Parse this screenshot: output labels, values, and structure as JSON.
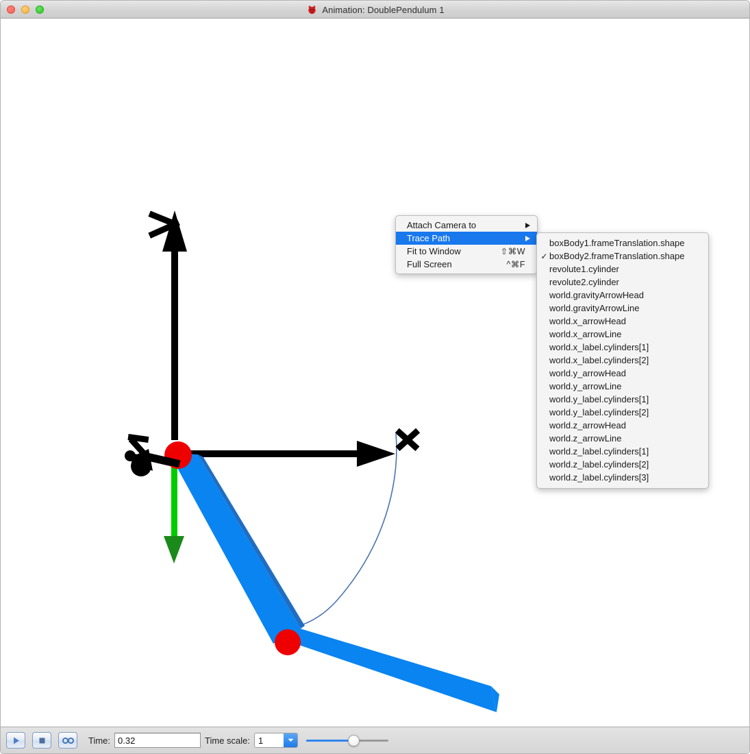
{
  "window": {
    "title": "Animation: DoublePendulum 1",
    "app_icon": "modelica-red-icon",
    "traffic_lights": [
      "close",
      "minimize",
      "maximize"
    ]
  },
  "context_menu": {
    "items": [
      {
        "label": "Attach Camera to",
        "shortcut": "",
        "submenu": true,
        "selected": false
      },
      {
        "label": "Trace Path",
        "shortcut": "",
        "submenu": true,
        "selected": true
      },
      {
        "label": "Fit to Window",
        "shortcut": "⇧⌘W",
        "submenu": false,
        "selected": false
      },
      {
        "label": "Full Screen",
        "shortcut": "^⌘F",
        "submenu": false,
        "selected": false
      }
    ]
  },
  "submenu": {
    "parent": "Trace Path",
    "items": [
      {
        "label": "boxBody1.frameTranslation.shape",
        "checked": false
      },
      {
        "label": "boxBody2.frameTranslation.shape",
        "checked": true
      },
      {
        "label": "revolute1.cylinder",
        "checked": false
      },
      {
        "label": "revolute2.cylinder",
        "checked": false
      },
      {
        "label": "world.gravityArrowHead",
        "checked": false
      },
      {
        "label": "world.gravityArrowLine",
        "checked": false
      },
      {
        "label": "world.x_arrowHead",
        "checked": false
      },
      {
        "label": "world.x_arrowLine",
        "checked": false
      },
      {
        "label": "world.x_label.cylinders[1]",
        "checked": false
      },
      {
        "label": "world.x_label.cylinders[2]",
        "checked": false
      },
      {
        "label": "world.y_arrowHead",
        "checked": false
      },
      {
        "label": "world.y_arrowLine",
        "checked": false
      },
      {
        "label": "world.y_label.cylinders[1]",
        "checked": false
      },
      {
        "label": "world.y_label.cylinders[2]",
        "checked": false
      },
      {
        "label": "world.z_arrowHead",
        "checked": false
      },
      {
        "label": "world.z_arrowLine",
        "checked": false
      },
      {
        "label": "world.z_label.cylinders[1]",
        "checked": false
      },
      {
        "label": "world.z_label.cylinders[2]",
        "checked": false
      },
      {
        "label": "world.z_label.cylinders[3]",
        "checked": false
      }
    ],
    "check_glyph": "✓"
  },
  "toolbar": {
    "play_icon": "play-icon",
    "stop_icon": "stop-icon",
    "loop_icon": "loop-icon",
    "time_label": "Time:",
    "time_value": "0.32",
    "timescale_label": "Time scale:",
    "timescale_value": "1",
    "timescale_options": [
      "1"
    ],
    "slider_value": 58
  },
  "scene": {
    "description": "3D animation of a double pendulum with world coordinate axes",
    "axes": [
      {
        "name": "y-axis",
        "label": "y",
        "color": "#000000",
        "direction": "up"
      },
      {
        "name": "x-axis",
        "label": "x",
        "color": "#000000",
        "direction": "right"
      },
      {
        "name": "z-axis",
        "label": "z",
        "color": "#000000",
        "direction": "back-left"
      }
    ],
    "gravity_arrow": {
      "name": "gravity-arrow",
      "color": "#00cc00",
      "direction": "down"
    },
    "links": [
      {
        "name": "boxBody1",
        "color": "#0a84f0"
      },
      {
        "name": "boxBody2",
        "color": "#0a84f0"
      }
    ],
    "joints": [
      {
        "name": "revolute1",
        "color": "#ee0000"
      },
      {
        "name": "revolute2",
        "color": "#ee0000"
      }
    ],
    "trace_path": {
      "name": "trace-path",
      "color": "#4a74b4"
    }
  }
}
